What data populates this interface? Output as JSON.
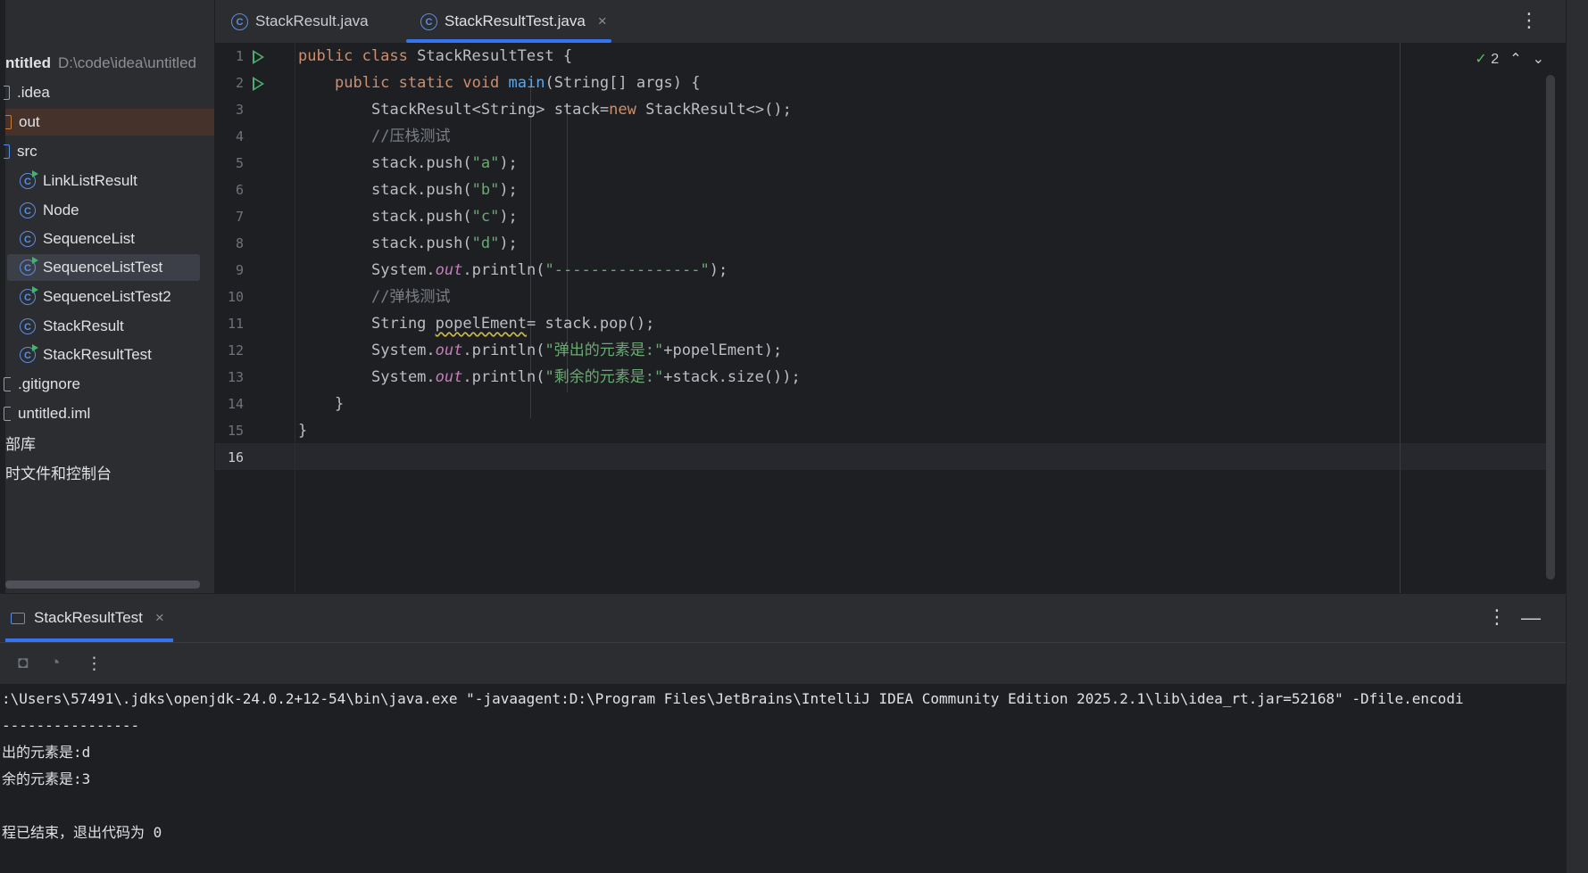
{
  "project": {
    "root_name": "ntitled",
    "root_path": "D:\\code\\idea\\untitled",
    "items": [
      {
        "label": ".idea",
        "kind": "folder"
      },
      {
        "label": "out",
        "kind": "folder-excluded"
      },
      {
        "label": "src",
        "kind": "folder-source"
      },
      {
        "label": "LinkListResult",
        "kind": "class-runnable"
      },
      {
        "label": "Node",
        "kind": "class"
      },
      {
        "label": "SequenceList",
        "kind": "class"
      },
      {
        "label": "SequenceListTest",
        "kind": "class-runnable",
        "selected": true
      },
      {
        "label": "SequenceListTest2",
        "kind": "class-runnable"
      },
      {
        "label": "StackResult",
        "kind": "class"
      },
      {
        "label": "StackResultTest",
        "kind": "class-runnable"
      },
      {
        "label": ".gitignore",
        "kind": "file"
      },
      {
        "label": "untitled.iml",
        "kind": "file"
      },
      {
        "label": "部库",
        "kind": "node"
      },
      {
        "label": "时文件和控制台",
        "kind": "node"
      }
    ]
  },
  "tabs": [
    {
      "label": "StackResult.java",
      "active": false
    },
    {
      "label": "StackResultTest.java",
      "active": true,
      "close": "×"
    }
  ],
  "editor": {
    "line_numbers": [
      "1",
      "2",
      "3",
      "4",
      "5",
      "6",
      "7",
      "8",
      "9",
      "10",
      "11",
      "12",
      "13",
      "14",
      "15",
      "16"
    ],
    "current_line": "16",
    "inspection_count": "2",
    "code": {
      "l1_kw1": "public",
      "l1_kw2": "class",
      "l1_rest": " StackResultTest {",
      "l2_kw1": "public",
      "l2_kw2": "static",
      "l2_kw3": "void",
      "l2_fn": "main",
      "l2_rest": "(String[] args) {",
      "l3_a": "StackResult<String> stack=",
      "l3_kw": "new",
      "l3_b": " StackResult<>();",
      "l4": "//压栈测试",
      "l5_a": "stack.push(",
      "l5_s": "\"a\"",
      "l5_b": ");",
      "l6_a": "stack.push(",
      "l6_s": "\"b\"",
      "l6_b": ");",
      "l7_a": "stack.push(",
      "l7_s": "\"c\"",
      "l7_b": ");",
      "l8_a": "stack.push(",
      "l8_s": "\"d\"",
      "l8_b": ");",
      "l9_a": "System.",
      "l9_f": "out",
      "l9_b": ".println(",
      "l9_s": "\"----------------\"",
      "l9_c": ");",
      "l10": "//弹栈测试",
      "l11_a": "String ",
      "l11_v": "popelEment",
      "l11_b": "= stack.pop();",
      "l12_a": "System.",
      "l12_f": "out",
      "l12_b": ".println(",
      "l12_s": "\"弹出的元素是:\"",
      "l12_c": "+popelEment);",
      "l13_a": "System.",
      "l13_f": "out",
      "l13_b": ".println(",
      "l13_s": "\"剩余的元素是:\"",
      "l13_c": "+stack.size());",
      "l14": "}",
      "l15": "}"
    }
  },
  "run_panel": {
    "tab_label": "StackResultTest",
    "close": "×",
    "console_lines": [
      ":\\Users\\57491\\.jdks\\openjdk-24.0.2+12-54\\bin\\java.exe \"-javaagent:D:\\Program Files\\JetBrains\\IntelliJ IDEA Community Edition 2025.2.1\\lib\\idea_rt.jar=52168\" -Dfile.encodi",
      "----------------",
      "出的元素是:d",
      "余的元素是:3",
      "",
      "程已结束，退出代码为 0"
    ]
  },
  "icons": [
    "class-icon",
    "run-icon",
    "check-icon",
    "chevron-up-icon",
    "chevron-down-icon",
    "more-icon",
    "minimize-icon",
    "camera-icon",
    "gauge-icon",
    "console-icon"
  ],
  "colors": {
    "accent": "#3574f0",
    "keyword": "#cf8e6d",
    "string": "#6aab73",
    "function": "#56a8f5",
    "comment": "#7a7e85",
    "field": "#c77dbb"
  }
}
